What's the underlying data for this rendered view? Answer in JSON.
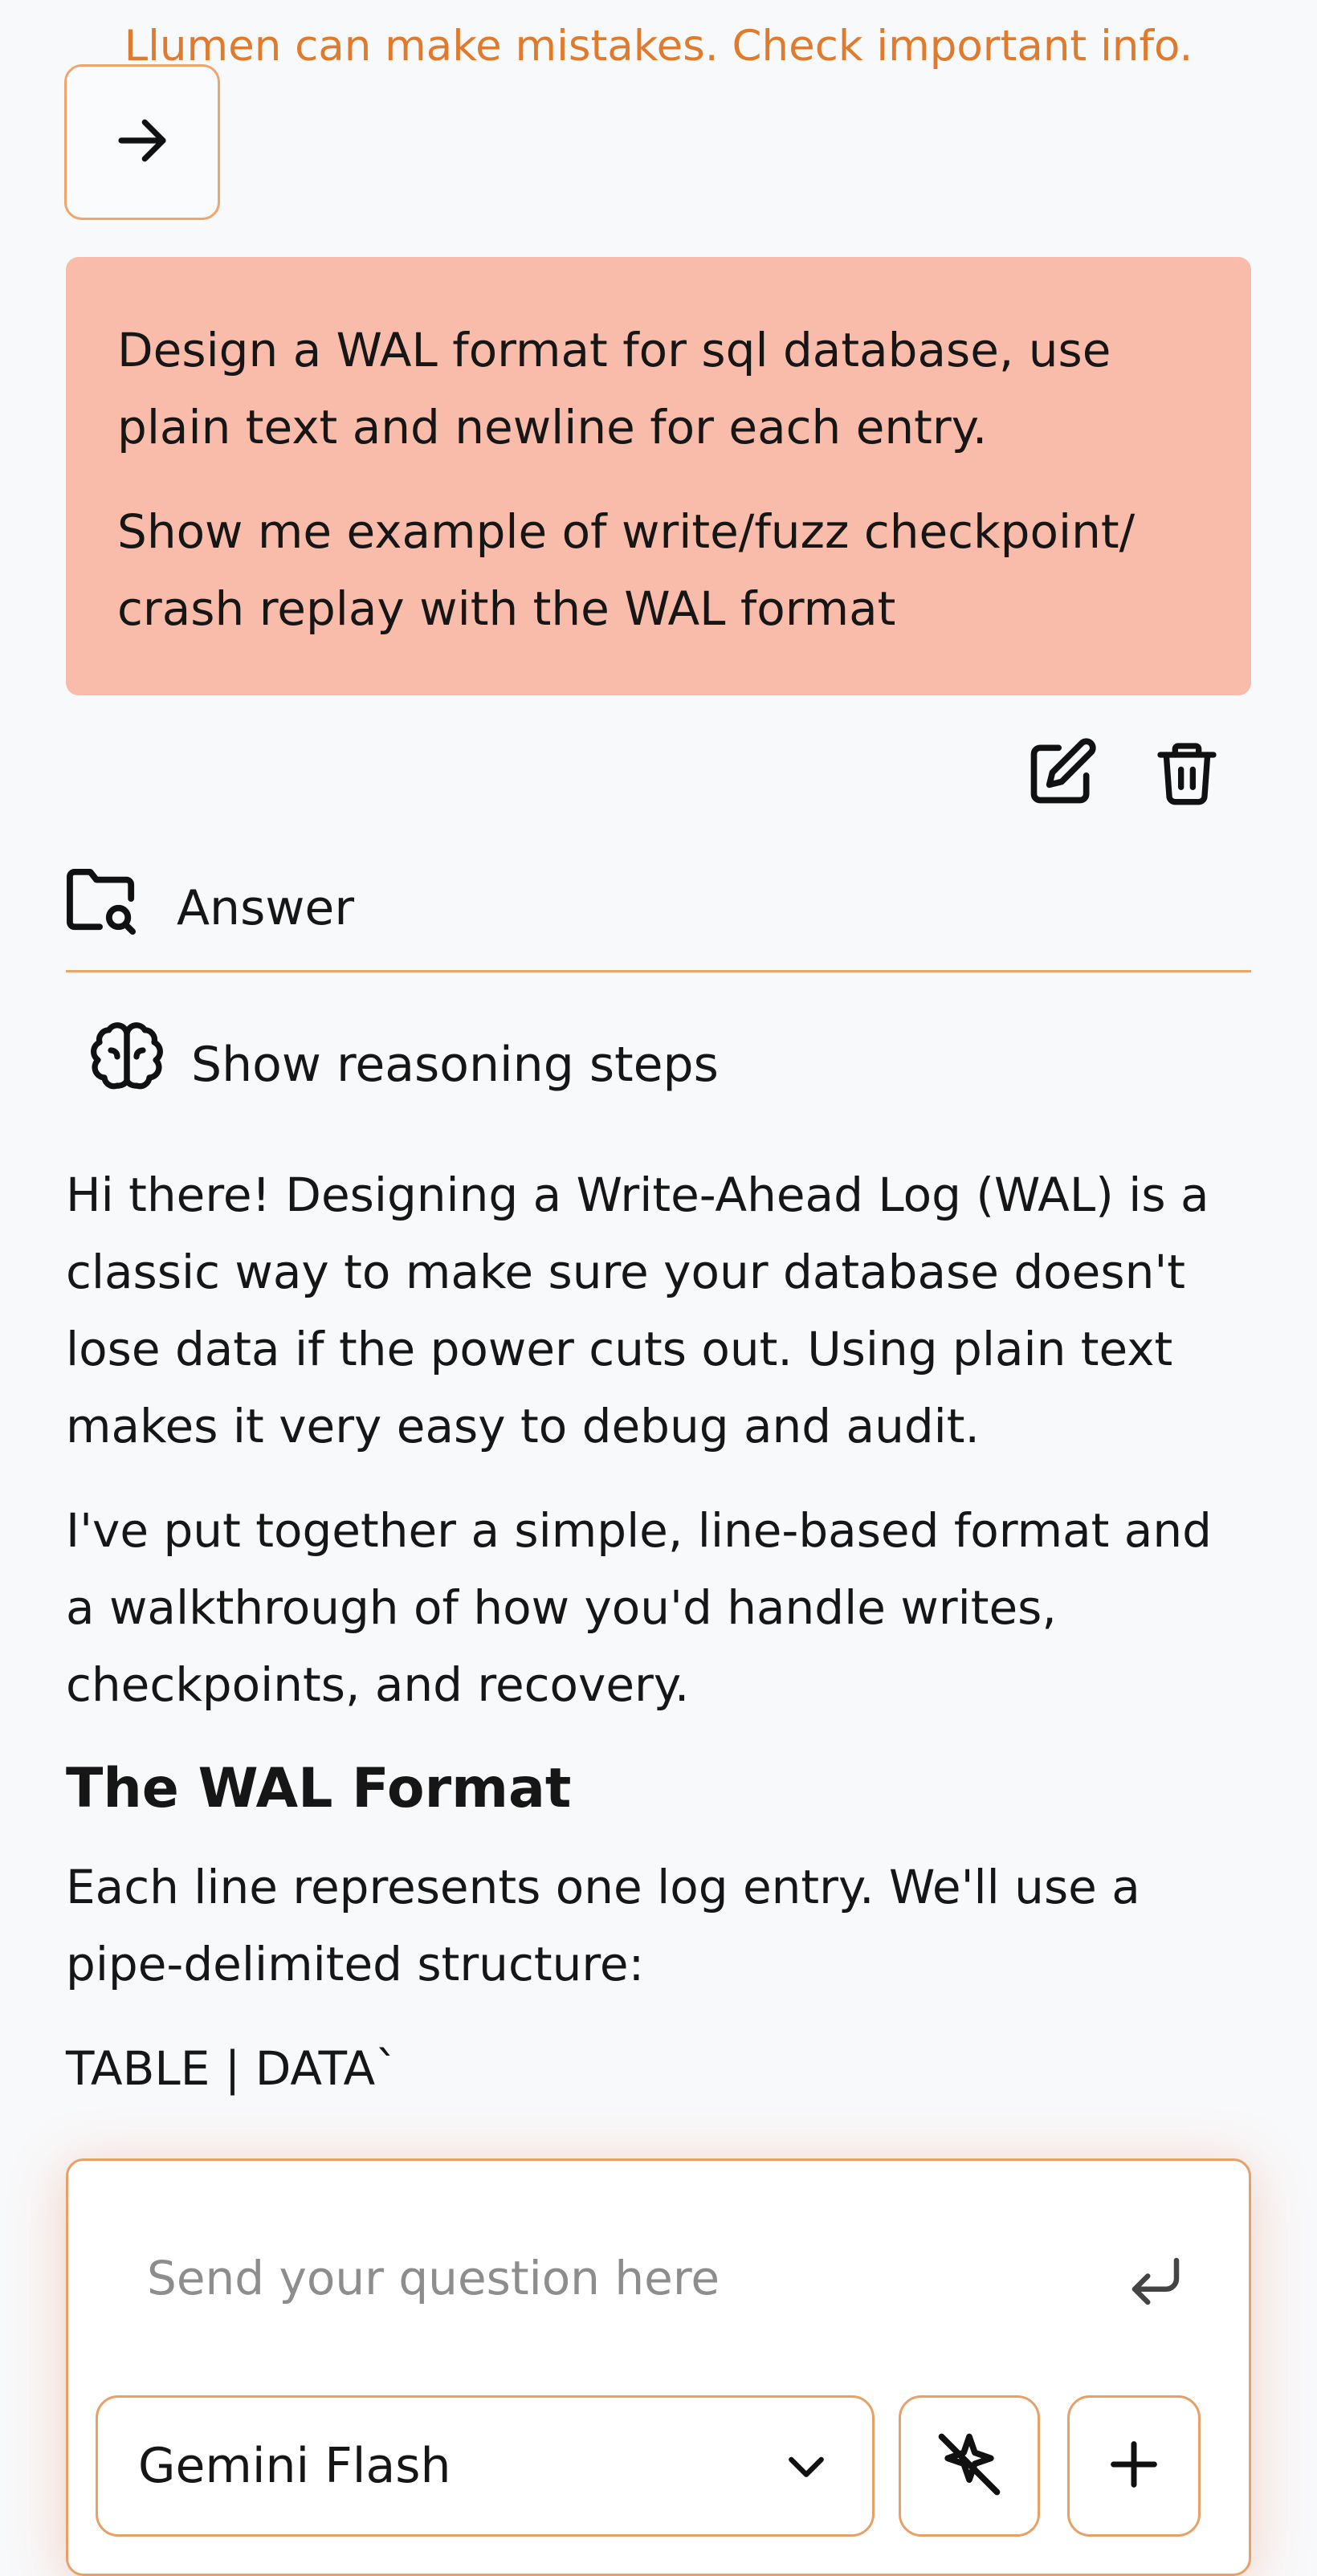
{
  "disclaimer": "Llumen can make mistakes. Check important info.",
  "user_message": {
    "paragraphs": [
      "Design a WAL format for sql database, use plain text and newline for each entry.",
      "Show me example of write/fuzz checkpoint/ crash replay with the WAL format"
    ]
  },
  "answer": {
    "label": "Answer",
    "reasoning_label": "Show reasoning steps",
    "paragraphs": [
      "Hi there! Designing a Write-Ahead Log (WAL) is a classic way to make sure your database doesn't lose data if the power cuts out. Using plain text makes it very easy to debug and audit.",
      "I've put together a simple, line-based format and a walkthrough of how you'd handle writes, checkpoints, and recovery."
    ],
    "section_heading": "The WAL Format",
    "section_paragraph": "Each line represents one log entry. We'll use a pipe-delimited structure:",
    "format_line": "TABLE | DATA`"
  },
  "composer": {
    "placeholder": "Send your question here",
    "model": "Gemini Flash"
  },
  "icons": {
    "nav": "arrow-right-icon",
    "edit": "edit-icon",
    "delete": "trash-icon",
    "answer": "folder-search-icon",
    "reasoning": "brain-icon",
    "send": "enter-icon",
    "model_toggle": "chevron-down-icon",
    "tools": "sparkle-off-icon",
    "add": "plus-icon"
  },
  "colors": {
    "accent": "#e07a2c",
    "user_bubble": "#f9bcaa",
    "border": "#e7a066"
  }
}
